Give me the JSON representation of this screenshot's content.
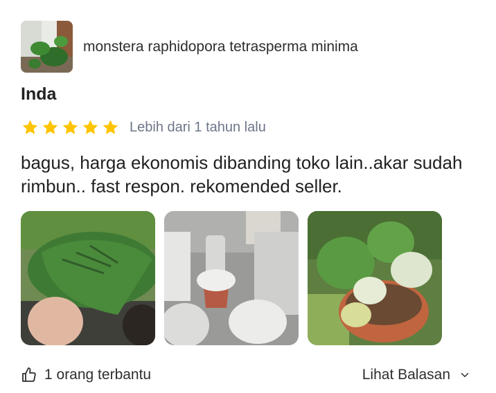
{
  "product": {
    "name": "monstera raphidopora tetrasperma minima",
    "thumbnail_icon": "monstera-thumbnail-icon"
  },
  "review": {
    "reviewer_name": "Inda",
    "rating": 5,
    "time_label": "Lebih dari 1 tahun lalu",
    "text": "bagus, harga ekonomis dibanding toko lain..akar sudah rimbun.. fast respon. rekomended seller."
  },
  "photos": [
    "monstera-leaf-photo",
    "wrapped-pots-photo",
    "potted-plant-photo"
  ],
  "footer": {
    "helpful_label": "1 orang terbantu",
    "view_replies_label": "Lihat Balasan"
  },
  "colors": {
    "star": "#FFC400",
    "muted_text": "#6d7588"
  }
}
